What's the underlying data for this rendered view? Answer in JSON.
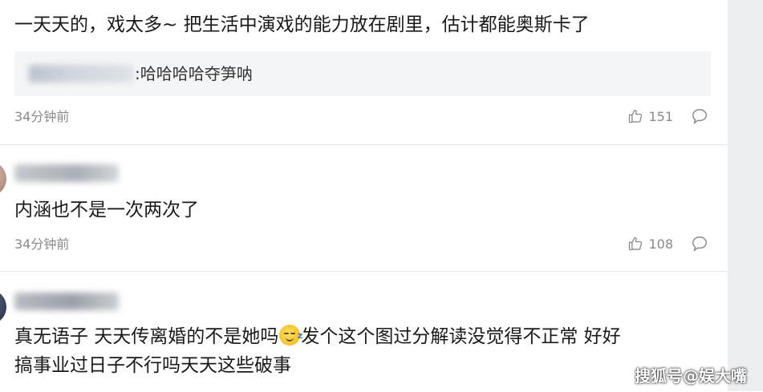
{
  "comments": [
    {
      "text": "一天天的，戏太多~ 把生活中演戏的能力放在剧里，估计都能奥斯卡了",
      "quote": {
        "text": ":哈哈哈哈夺笋呐"
      },
      "time": "34分钟前",
      "likes": "151"
    },
    {
      "text": "内涵也不是一次两次了",
      "time": "34分钟前",
      "likes": "108"
    },
    {
      "text_line1_a": "真无语子 天天传离婚的不是她吗",
      "text_line1_b": "发个这个图过分解读没觉得不正常 好好",
      "text_line2": "搞事业过日子不行吗天天这些破事"
    }
  ],
  "watermark": "搜狐号@娱大嘴",
  "icons": {
    "like": "thumbs-up-icon",
    "reply": "comment-bubble-icon",
    "emoji": "sleepy-emoji-icon"
  },
  "colors": {
    "text": "#1a1a1a",
    "meta": "#8a8a8a",
    "quote_bg": "#f4f5f6",
    "sidebar": "#eceef0"
  }
}
